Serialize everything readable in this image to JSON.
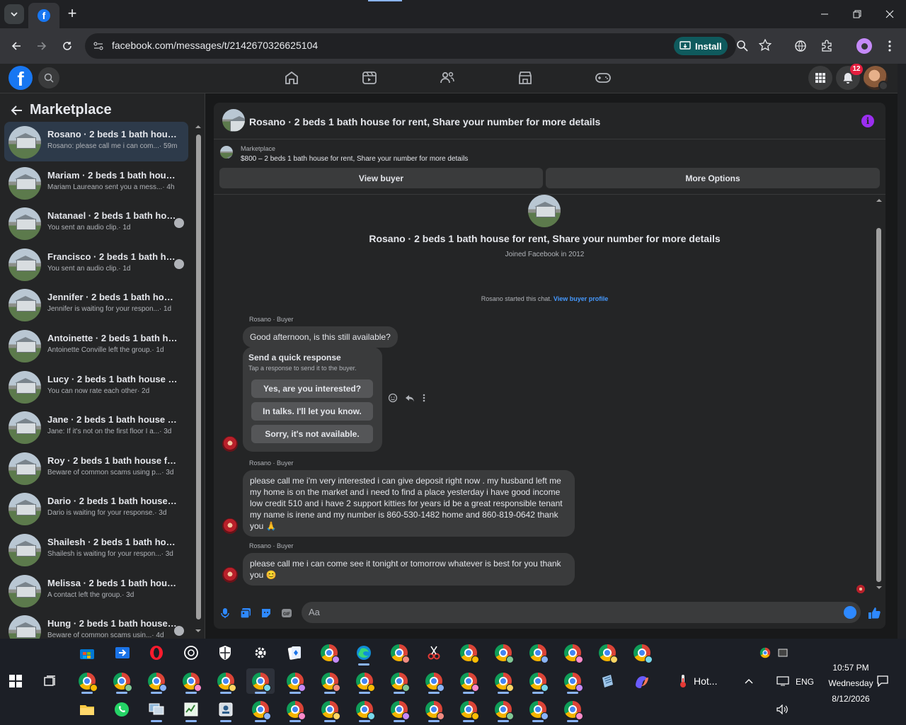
{
  "browser": {
    "url": "facebook.com/messages/t/2142670326625104",
    "install_label": "Install",
    "new_tab": "+"
  },
  "fb": {
    "logo": "f",
    "notification_count": "12"
  },
  "sidebar": {
    "title": "Marketplace",
    "conversations": [
      {
        "name": "Rosano · 2 beds 1 bath house fo...",
        "snippet": "Rosano: please call me i can com...",
        "time": "· 59m",
        "active": true
      },
      {
        "name": "Mariam · 2 beds 1 bath house f...",
        "snippet": "Mariam Laureano sent you a mess...",
        "time": "· 4h"
      },
      {
        "name": "Natanael · 2 beds 1 bath hous...",
        "snippet": "You sent an audio clip.",
        "time": "· 1d"
      },
      {
        "name": "Francisco · 2 beds 1 bath hou...",
        "snippet": "You sent an audio clip.",
        "time": "· 1d"
      },
      {
        "name": "Jennifer · 2 beds 1 bath house f...",
        "snippet": "Jennifer is waiting for your respon...",
        "time": "· 1d"
      },
      {
        "name": "Antoinette · 2 beds 1 bath hous...",
        "snippet": "Antoinette Conville left the group.",
        "time": "· 1d"
      },
      {
        "name": "Lucy · 2 beds 1 bath house for r...",
        "snippet": "You can now rate each other",
        "time": "· 2d"
      },
      {
        "name": "Jane · 2 beds 1 bath house for r...",
        "snippet": "Jane: If it's not on the first floor I a...",
        "time": "· 3d"
      },
      {
        "name": "Roy · 2 beds 1 bath house for re...",
        "snippet": "Beware of common scams using p...",
        "time": "· 3d"
      },
      {
        "name": "Dario · 2 beds 1 bath house for ...",
        "snippet": "Dario is waiting for your response.",
        "time": "· 3d"
      },
      {
        "name": "Shailesh · 2 beds 1 bath house f...",
        "snippet": "Shailesh is waiting for your respon...",
        "time": "· 3d"
      },
      {
        "name": "Melissa · 2 beds 1 bath house fo...",
        "snippet": "A contact left the group.",
        "time": "· 3d"
      },
      {
        "name": "Hung · 2 beds 1 bath house f...",
        "snippet": "Beware of common scams usin...",
        "time": "· 4d"
      }
    ]
  },
  "chat": {
    "title": "Rosano · 2 beds 1 bath house for rent, Share your number for more details",
    "listing_label": "Marketplace",
    "listing_title": "$800 – 2 beds 1 bath house for rent, Share your number for more details",
    "view_buyer": "View buyer",
    "more_options": "More Options",
    "intro_title": "Rosano · 2 beds 1 bath house for rent, Share your number for more details",
    "intro_sub": "Joined Facebook in 2012",
    "started_text": "Rosano started this chat.",
    "started_link": "View buyer profile",
    "sender_label": "Rosano · Buyer",
    "msg1": "Good afternoon, is this still available?",
    "quick_title": "Send a quick response",
    "quick_sub": "Tap a response to send it to the buyer.",
    "quick_responses": [
      "Yes, are you interested?",
      "In talks. I'll let you know.",
      "Sorry, it's not available."
    ],
    "msg2": "please call me i'm very interested i can give deposit right now . my husband left me my home is on the market and i need to find a place yesterday i have good income low credit 510 and i have 2 support kitties  for years id be a great responsible tenant my name is irene and my number is 860-530-1482 home and 860-819-0642 thank you 🙏",
    "msg3": "please call me i can come see it tonight  or tomorrow whatever is best for you thank you 😊",
    "composer_placeholder": "Aa"
  },
  "taskbar": {
    "weather": "Hot...",
    "lang": "ENG",
    "time": "10:57 PM",
    "day": "Wednesday",
    "date": "8/12/2026"
  },
  "colors": {
    "accent_blue": "#1877f2",
    "link_blue": "#4599ff",
    "info_purple": "#9b2ef0",
    "badge_red": "#e41e3f"
  }
}
